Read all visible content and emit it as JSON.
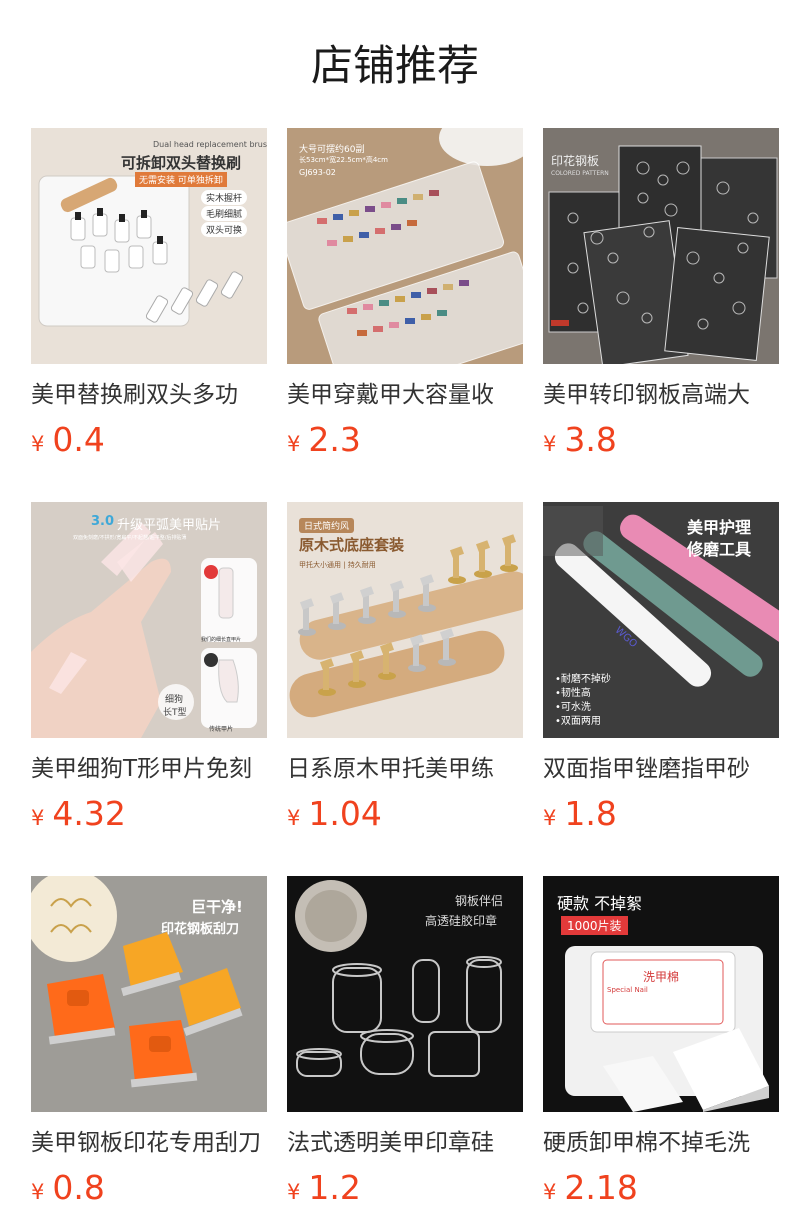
{
  "header": {
    "title": "店铺推荐"
  },
  "products": [
    {
      "name": "美甲替换刷双头多功",
      "currency": "¥",
      "price": "0.4",
      "image_text": [
        "Dual head replacement brush",
        "可拆卸双头替换刷",
        "无需安装 可单独拆卸",
        "实木握杆",
        "毛刷细腻",
        "双头可换"
      ]
    },
    {
      "name": "美甲穿戴甲大容量收",
      "currency": "¥",
      "price": "2.3",
      "image_text": [
        "大号可摆约60副",
        "长53cm*宽22.5cm*高4cm",
        "GJ693-02"
      ]
    },
    {
      "name": "美甲转印钢板高端大",
      "currency": "¥",
      "price": "3.8",
      "image_text": [
        "印花钢板",
        "COLORED PATTERN"
      ]
    },
    {
      "name": "美甲细狗T形甲片免刻",
      "currency": "¥",
      "price": "4.32",
      "image_text": [
        "3.0",
        "升级平弧美甲贴片",
        "双面免刻磨/不拱形/宽扁平/不起翘/超平整/后排贴薄",
        "细狗",
        "长T型",
        "我们的细长直甲片",
        "传统甲片"
      ]
    },
    {
      "name": "日系原木甲托美甲练",
      "currency": "¥",
      "price": "1.04",
      "image_text": [
        "日式简约风",
        "原木式底座套装",
        "甲托大小通用 | 持久耐用"
      ]
    },
    {
      "name": "双面指甲锉磨指甲砂",
      "currency": "¥",
      "price": "1.8",
      "image_text": [
        "美甲护理",
        "修磨工具",
        "•耐磨不掉砂",
        "•韧性高",
        "•可水洗",
        "•双面两用",
        "WGO"
      ]
    },
    {
      "name": "美甲钢板印花专用刮刀",
      "currency": "¥",
      "price": "0.8",
      "image_text": [
        "巨干净!",
        "印花钢板刮刀"
      ]
    },
    {
      "name": "法式透明美甲印章硅",
      "currency": "¥",
      "price": "1.2",
      "image_text": [
        "钢板伴侣",
        "高透硅胶印章"
      ]
    },
    {
      "name": "硬质卸甲棉不掉毛洗",
      "currency": "¥",
      "price": "2.18",
      "image_text": [
        "硬款 不掉絮",
        "1000片装",
        "洗甲棉",
        "Special Nail"
      ]
    }
  ],
  "colors": {
    "price": "#f0421e",
    "title": "#1a1a1a",
    "name": "#333333"
  }
}
